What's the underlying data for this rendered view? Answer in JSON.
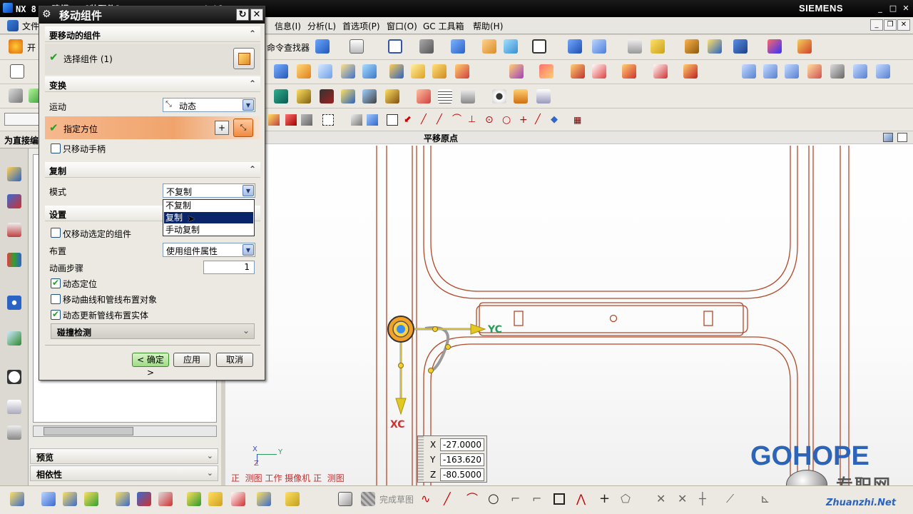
{
  "window": {
    "title": "NX 8 - 建模 - [装配件] yz_top_109.prt  (!)]",
    "brand": "SIEMENS"
  },
  "menubar": {
    "items": [
      "文件",
      "信息(I)",
      "分析(L)",
      "首选项(P)",
      "窗口(O)",
      "GC 工具箱",
      "帮助(H)"
    ]
  },
  "toolbar": {
    "start_label": "开",
    "command_finder": "命令查找器"
  },
  "nav": {
    "header": "为直接编",
    "preview": "预览",
    "dependencies": "相依性"
  },
  "graphics": {
    "view_title": "平移原点",
    "yc_label": "YC",
    "xc_label": "XC",
    "triad_y": "Y",
    "triad_x": "X",
    "triad_z": "Z",
    "coords": {
      "x": "-27.0000",
      "y": "-163.620",
      "z": "-80.5000"
    },
    "coord_labels": {
      "x": "X",
      "y": "Y",
      "z": "Z"
    },
    "status_text": "正  测图 工作 摄像机 正  测图",
    "watermark": "GOHOPE",
    "site_text": "专职网",
    "site_url": "Zhuanzhi.Net"
  },
  "bottombar": {
    "finish_sketch": "完成草图"
  },
  "dialog": {
    "title": "移动组件",
    "sections": {
      "components": {
        "header": "要移动的组件",
        "select_label": "选择组件 (1)"
      },
      "transform": {
        "header": "变换",
        "motion_label": "运动",
        "motion_value": "动态",
        "orientation_label": "指定方位",
        "only_handle_label": "只移动手柄"
      },
      "copy": {
        "header": "复制",
        "mode_label": "模式",
        "mode_value": "不复制",
        "options": [
          "不复制",
          "复制",
          "手动复制"
        ],
        "highlighted_option": "复制"
      },
      "settings": {
        "header": "设置",
        "only_selected_label": "仅移动选定的组件",
        "layout_label": "布置",
        "layout_value": "使用组件属性",
        "anim_steps_label": "动画步骤",
        "anim_steps_value": "1",
        "dynamic_pos_label": "动态定位",
        "move_curves_label": "移动曲线和管线布置对象",
        "dynamic_update_label": "动态更新管线布置实体",
        "collision_label": "碰撞检测"
      }
    },
    "buttons": {
      "ok": "< 确定 >",
      "apply": "应用",
      "cancel": "取消"
    }
  },
  "colors": {
    "dialog_title_bg": "#1a1a1a",
    "highlight_orange": "#f2a46a",
    "selection_blue": "#0a246a",
    "model_line": "#b24a2a",
    "axis_yellow": "#d8c21a"
  }
}
